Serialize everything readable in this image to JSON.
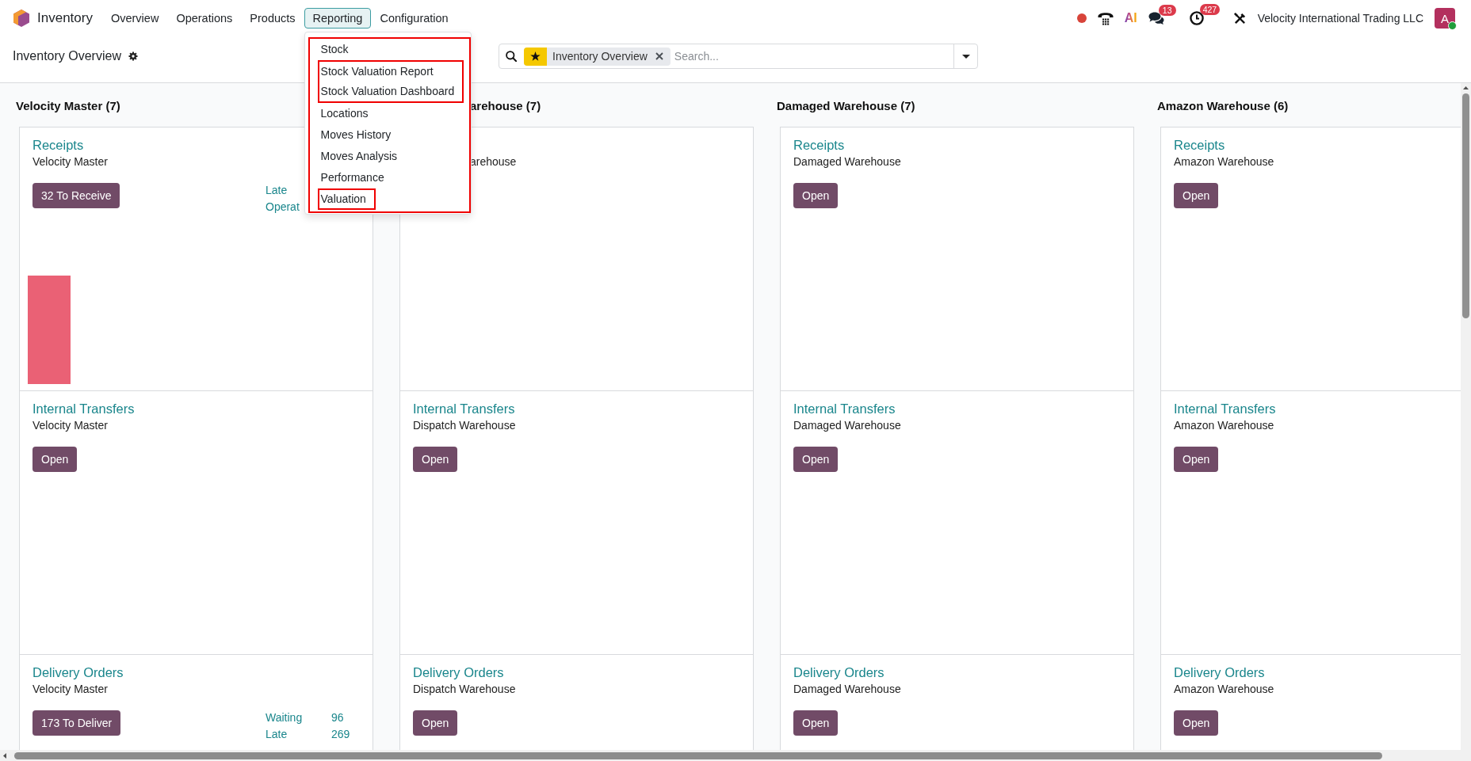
{
  "navbar": {
    "app_name": "Inventory",
    "menu": [
      {
        "label": "Overview",
        "expanded": false
      },
      {
        "label": "Operations",
        "expanded": false
      },
      {
        "label": "Products",
        "expanded": false
      },
      {
        "label": "Reporting",
        "expanded": true,
        "dropdown": {
          "highlighted": true,
          "items": [
            {
              "label": "Stock",
              "highlighted": false
            },
            {
              "label": "Stock Valuation Report",
              "highlighted": true
            },
            {
              "label": "Stock Valuation Dashboard",
              "highlighted": true
            },
            {
              "label": "Locations",
              "highlighted": false
            },
            {
              "label": "Moves History",
              "highlighted": false
            },
            {
              "label": "Moves Analysis",
              "highlighted": false
            },
            {
              "label": "Performance",
              "highlighted": false
            },
            {
              "label": "Valuation",
              "highlighted": true
            }
          ]
        }
      },
      {
        "label": "Configuration",
        "expanded": false
      }
    ]
  },
  "systray": {
    "ai_label": "AI",
    "messages_count": "13",
    "activities_count": "427",
    "company": "Velocity International Trading LLC",
    "user_initial": "A",
    "user_online": true
  },
  "control_panel": {
    "title": "Inventory Overview",
    "search": {
      "facet": "Inventory Overview",
      "placeholder": "Search..."
    }
  },
  "columns": [
    {
      "title": "Velocity Master (7)",
      "cards": [
        {
          "title": "Receipts",
          "subtitle": "Velocity Master",
          "button": "32 To Receive",
          "graph": true,
          "stats": [
            {
              "label": "Late"
            },
            {
              "label": "Operat"
            }
          ]
        },
        {
          "title": "Internal Transfers",
          "subtitle": "Velocity Master",
          "button": "Open"
        },
        {
          "title": "Delivery Orders",
          "subtitle": "Velocity Master",
          "button": "173 To Deliver",
          "stats": [
            {
              "label": "Waiting",
              "value": "96"
            },
            {
              "label": "Late",
              "value": "269"
            }
          ]
        }
      ]
    },
    {
      "title": "arehouse (7)",
      "cards": [
        {
          "subtitle": "arehouse"
        },
        {
          "title": "Internal Transfers",
          "subtitle": "Dispatch Warehouse",
          "button": "Open"
        },
        {
          "title": "Delivery Orders",
          "subtitle": "Dispatch Warehouse",
          "button": "Open"
        }
      ]
    },
    {
      "title": "Damaged Warehouse (7)",
      "cards": [
        {
          "title": "Receipts",
          "subtitle": "Damaged Warehouse",
          "button": "Open"
        },
        {
          "title": "Internal Transfers",
          "subtitle": "Damaged Warehouse",
          "button": "Open"
        },
        {
          "title": "Delivery Orders",
          "subtitle": "Damaged Warehouse",
          "button": "Open"
        }
      ]
    },
    {
      "title": "Amazon Warehouse (6)",
      "cards": [
        {
          "title": "Receipts",
          "subtitle": "Amazon Warehouse",
          "button": "Open"
        },
        {
          "title": "Internal Transfers",
          "subtitle": "Amazon Warehouse",
          "button": "Open"
        },
        {
          "title": "Delivery Orders",
          "subtitle": "Amazon Warehouse",
          "button": "Open"
        }
      ]
    }
  ]
}
